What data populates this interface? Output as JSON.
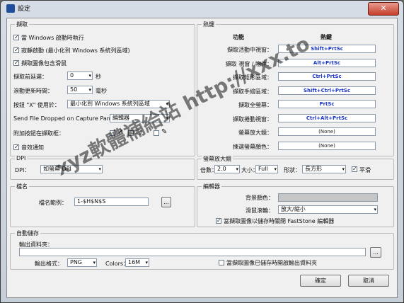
{
  "window": {
    "title": "設定",
    "close": "✕"
  },
  "capture": {
    "group": "擷取",
    "cb_startup": "當 Windows 啟動時執行",
    "cb_silent": "寂靜啟動 (最小化到 Windows 系統列區域)",
    "cb_cursor": "擷取圖像包含滑鼠",
    "delay_label": "擷取前延遲：",
    "delay_value": "0",
    "delay_unit": "秒",
    "scroll_label": "滾動更新時間：",
    "scroll_value": "50",
    "scroll_unit": "毫秒",
    "x_label": "按鈕 \"X\" 使用於：",
    "x_value": "最小化到 Windows 系統列區域",
    "send_label": "Send File Dropped on Capture Panel to :",
    "send_value": "編輯器",
    "attach_label": "附加按鈕在擷取框：",
    "sound_label": "音效通知"
  },
  "hotkeys": {
    "group": "熱鍵",
    "col_function": "功能",
    "col_hotkey": "熱鍵",
    "rows": [
      {
        "label": "擷取活動中視窗：",
        "key": "Shift+PrtSc"
      },
      {
        "label": "擷取 視窗 / 物件：",
        "key": "Alt+PrtSc"
      },
      {
        "label": "擷取矩形區域：",
        "key": "Ctrl+PrtSc"
      },
      {
        "label": "擷取手繪區域：",
        "key": "Shift+Ctrl+PrtSc"
      },
      {
        "label": "擷取全螢幕：",
        "key": "PrtSc"
      },
      {
        "label": "擷取捲動視窗：",
        "key": "Ctrl+Alt+PrtSc"
      },
      {
        "label": "螢幕放大鏡：",
        "key": "(None)"
      },
      {
        "label": "揀選螢幕顏色：",
        "key": "(None)"
      }
    ]
  },
  "dpi": {
    "group": "DPI",
    "label": "DPI：",
    "value": "如螢幕 DPI"
  },
  "magnifier": {
    "group": "螢幕放大鏡",
    "ratio_label": "倍數：",
    "ratio_value": "2.0",
    "size_label": "大小：",
    "size_value": "Full",
    "shape_label": "形狀：",
    "shape_value": "長方形",
    "smooth_label": "平滑"
  },
  "filename": {
    "group": "檔名",
    "label": "檔名範例：",
    "value": "1-$H$N$S",
    "browse": "..."
  },
  "editor": {
    "group": "編輯器",
    "bg_label": "背景顏色：",
    "wheel_label": "滑鼠滾輪：",
    "wheel_value": "放大/縮小",
    "close_cb": "當擷取圖像以儲存時關閉 FastStone 編輯器"
  },
  "autosave": {
    "group": "自動儲存",
    "output_label": "輸出資料夾：",
    "browse": "...",
    "format_label": "輸出格式：",
    "format_value": "PNG",
    "colors_label": "Colors：",
    "colors_value": "16M",
    "open_cb": "當擷取圖像已儲存時開啟輸出資料夾"
  },
  "footer": {
    "ok": "確定",
    "cancel": "取消"
  },
  "watermark": "xyz軟體補給站 http://xxx.to"
}
